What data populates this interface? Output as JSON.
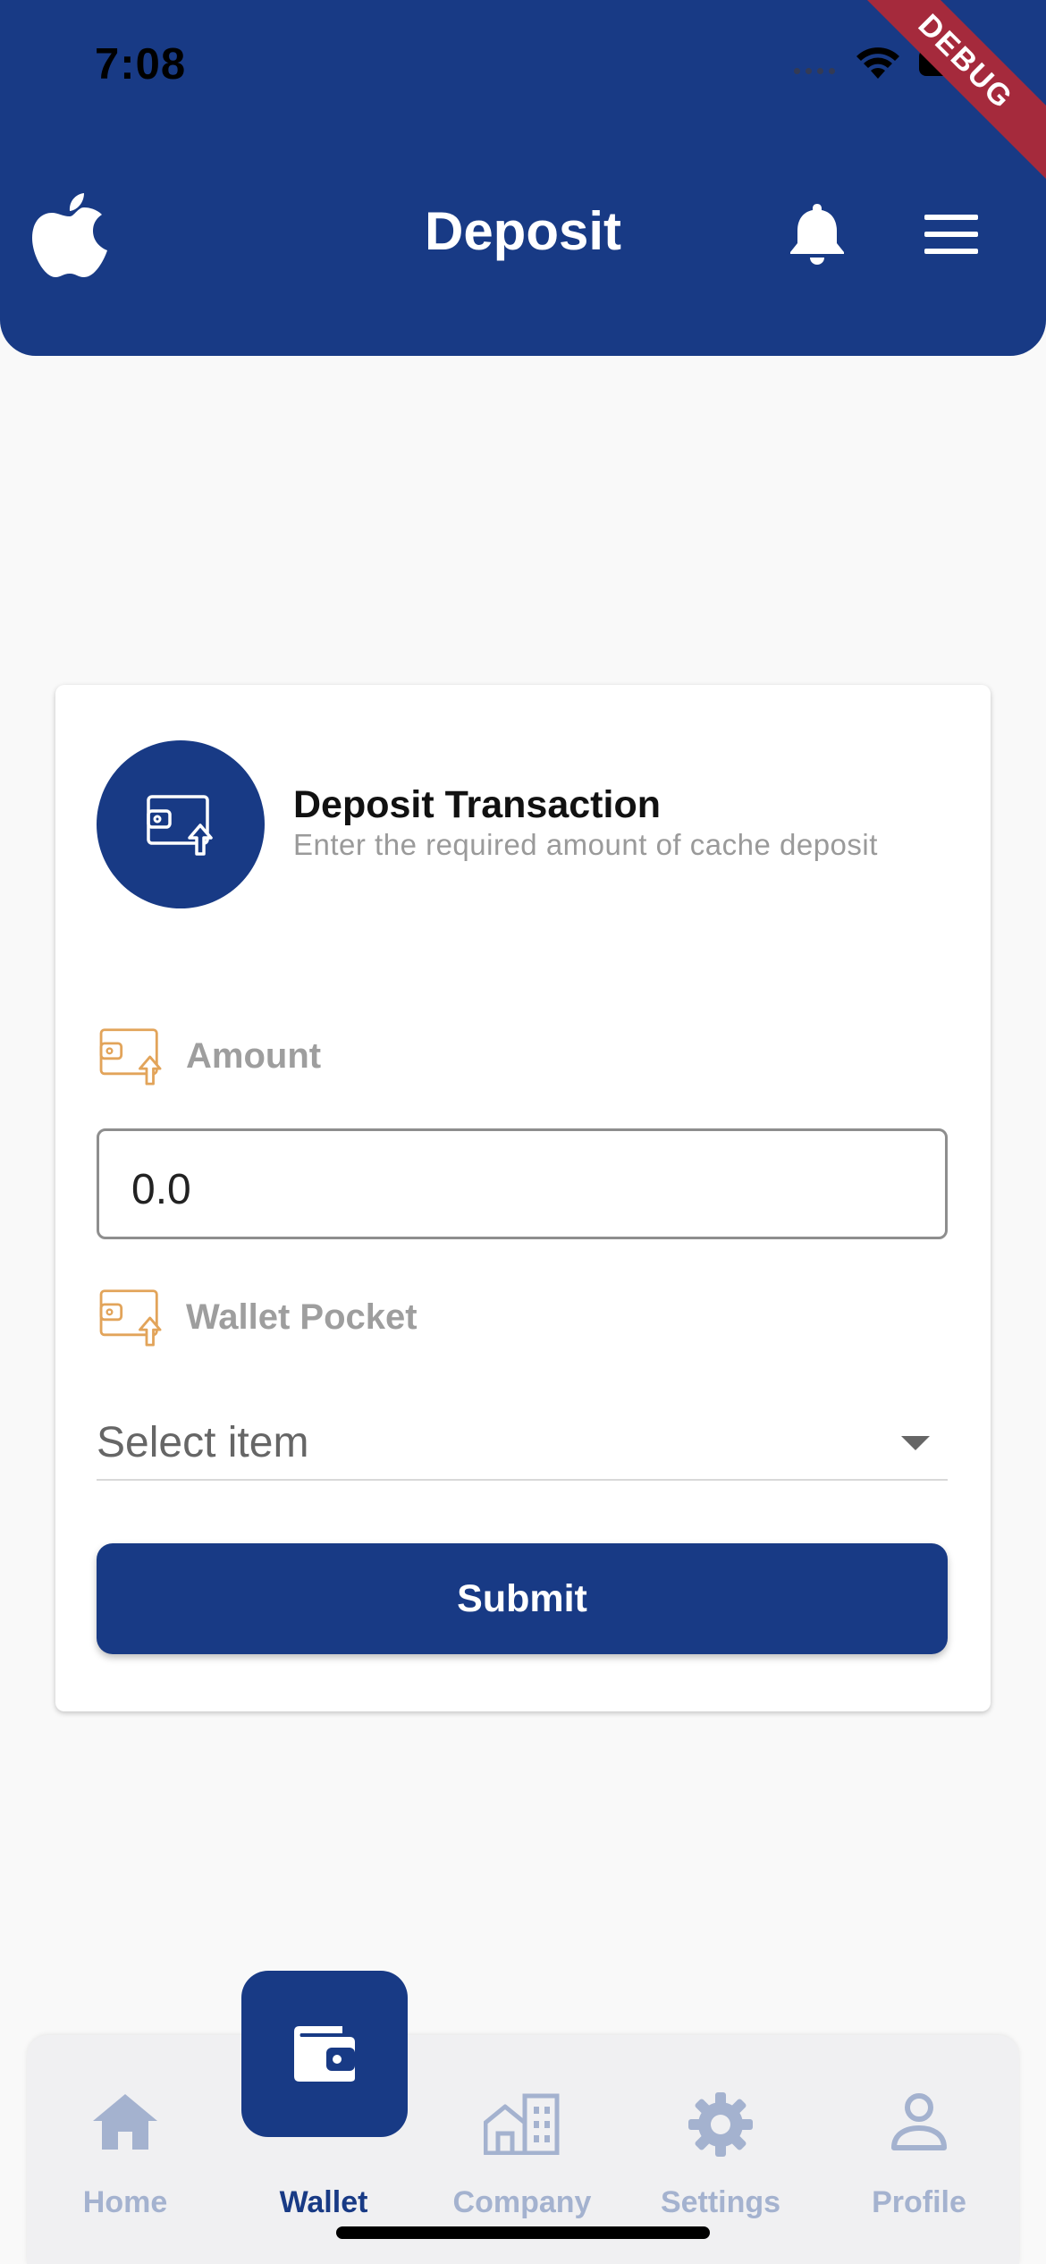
{
  "status_bar": {
    "time": "7:08",
    "debug_label": "DEBUG"
  },
  "header": {
    "title": "Deposit",
    "icons": {
      "left": "apple-icon",
      "notification": "bell-icon",
      "menu": "menu-icon"
    }
  },
  "card": {
    "title": "Deposit Transaction",
    "subtitle": "Enter the required amount of cache deposit",
    "amount_label": "Amount",
    "amount_value": "0.0",
    "wallet_pocket_label": "Wallet Pocket",
    "select_placeholder": "Select item",
    "submit_label": "Submit"
  },
  "bottom_nav": {
    "items": [
      {
        "label": "Home",
        "icon": "home-icon"
      },
      {
        "label": "Wallet",
        "icon": "wallet-icon",
        "active": true
      },
      {
        "label": "Company",
        "icon": "company-icon"
      },
      {
        "label": "Settings",
        "icon": "gear-icon"
      },
      {
        "label": "Profile",
        "icon": "user-icon"
      }
    ]
  },
  "colors": {
    "primary": "#183a85",
    "accent": "#e2a45a",
    "inactive": "#a4b2cf",
    "background": "#f9f9f9"
  }
}
